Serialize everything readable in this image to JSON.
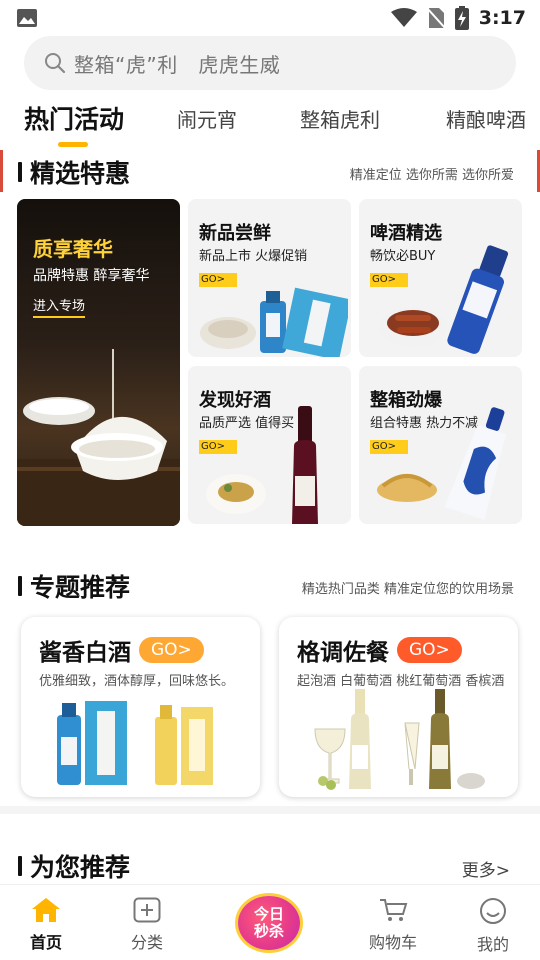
{
  "status_bar": {
    "time": "3:17"
  },
  "search": {
    "placeholder": "整箱“虎”利　虎虎生威"
  },
  "tabs": [
    {
      "label": "热门活动",
      "active": true
    },
    {
      "label": "闹元宵",
      "active": false
    },
    {
      "label": "整箱虎利",
      "active": false
    },
    {
      "label": "精酿啤酒",
      "active": false
    }
  ],
  "deals_section": {
    "title": "精选特惠",
    "subtitle": "精准定位 选你所需 选你所爱"
  },
  "featured_promo": {
    "title": "质享奢华",
    "subtitle": "品牌特惠 醉享奢华",
    "link": "进入专场"
  },
  "deal_cards": [
    {
      "title": "新品尝鲜",
      "subtitle": "新品上市 火爆促销",
      "go": "GO>"
    },
    {
      "title": "啤酒精选",
      "subtitle": "畅饮必BUY",
      "go": "GO>"
    },
    {
      "title": "发现好酒",
      "subtitle": "品质严选 值得买",
      "go": "GO>"
    },
    {
      "title": "整箱劲爆",
      "subtitle": "组合特惠 热力不减",
      "go": "GO>"
    }
  ],
  "topics_section": {
    "title": "专题推荐",
    "subtitle": "精选热门品类 精准定位您的饮用场景"
  },
  "topic_cards": [
    {
      "title": "酱香白酒",
      "go": "GO>",
      "subtitle": "优雅细致，酒体醇厚，回味悠长。",
      "go_color": "#ffa733"
    },
    {
      "title": "格调佐餐",
      "go": "GO>",
      "subtitle": "起泡酒 白葡萄酒 桃红葡萄酒 香槟酒",
      "go_color": "#ff5a2a"
    }
  ],
  "recommend_section": {
    "title": "为您推荐",
    "more": "更多>"
  },
  "bottom_nav": [
    {
      "label": "首页",
      "icon": "home-icon",
      "active": true
    },
    {
      "label": "分类",
      "icon": "category-icon",
      "active": false
    },
    {
      "label": "购物车",
      "icon": "cart-icon",
      "active": false
    },
    {
      "label": "我的",
      "icon": "profile-icon",
      "active": false
    }
  ],
  "flash_sale": {
    "line1": "今日",
    "line2": "秒杀"
  },
  "colors": {
    "accent": "#ffb400",
    "go_yellow": "#ffcc1a"
  }
}
